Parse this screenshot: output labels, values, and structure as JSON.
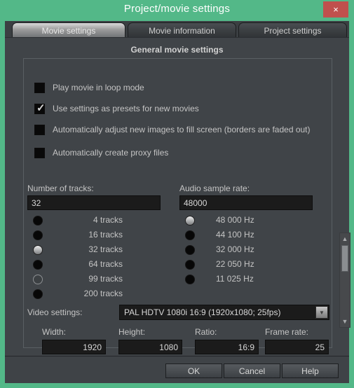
{
  "window": {
    "title": "Project/movie settings",
    "close_label": "×"
  },
  "tabs": [
    {
      "label": "Movie settings",
      "active": true
    },
    {
      "label": "Movie information",
      "active": false
    },
    {
      "label": "Project settings",
      "active": false
    }
  ],
  "panel": {
    "heading": "General movie settings",
    "checkboxes": [
      {
        "label": "Play movie in loop mode",
        "checked": false
      },
      {
        "label": "Use settings as presets for new movies",
        "checked": true
      },
      {
        "label": "Automatically adjust new images to fill screen (borders are faded out)",
        "checked": false
      },
      {
        "label": "Automatically create proxy files",
        "checked": false
      }
    ],
    "tracks": {
      "label": "Number of tracks:",
      "value": "32",
      "options": [
        {
          "label": "4 tracks",
          "state": "off"
        },
        {
          "label": "16 tracks",
          "state": "off"
        },
        {
          "label": "32 tracks",
          "state": "selected"
        },
        {
          "label": "64 tracks",
          "state": "off"
        },
        {
          "label": "99 tracks",
          "state": "ring"
        },
        {
          "label": "200 tracks",
          "state": "off"
        }
      ]
    },
    "sample_rate": {
      "label": "Audio sample rate:",
      "value": "48000",
      "options": [
        {
          "label": "48 000 Hz",
          "state": "selected"
        },
        {
          "label": "44 100 Hz",
          "state": "off"
        },
        {
          "label": "32 000 Hz",
          "state": "off"
        },
        {
          "label": "22 050 Hz",
          "state": "off"
        },
        {
          "label": "11 025 Hz",
          "state": "off"
        }
      ],
      "scrollbar": {
        "up": "▲",
        "down": "▼"
      }
    },
    "video": {
      "label": "Video settings:",
      "selected": "PAL HDTV 1080i 16:9 (1920x1080; 25fps)",
      "arrow": "▼",
      "fields": [
        {
          "label": "Width:",
          "value": "1920"
        },
        {
          "label": "Height:",
          "value": "1080"
        },
        {
          "label": "Ratio:",
          "value": "16:9"
        },
        {
          "label": "Frame rate:",
          "value": "25"
        }
      ]
    }
  },
  "footer": {
    "ok": "OK",
    "cancel": "Cancel",
    "help": "Help"
  },
  "colors": {
    "window_border": "#53b888",
    "close_button": "#c0504d",
    "panel_bg": "#404448",
    "input_bg": "#1b1b1b",
    "text": "#c4c4c4"
  }
}
